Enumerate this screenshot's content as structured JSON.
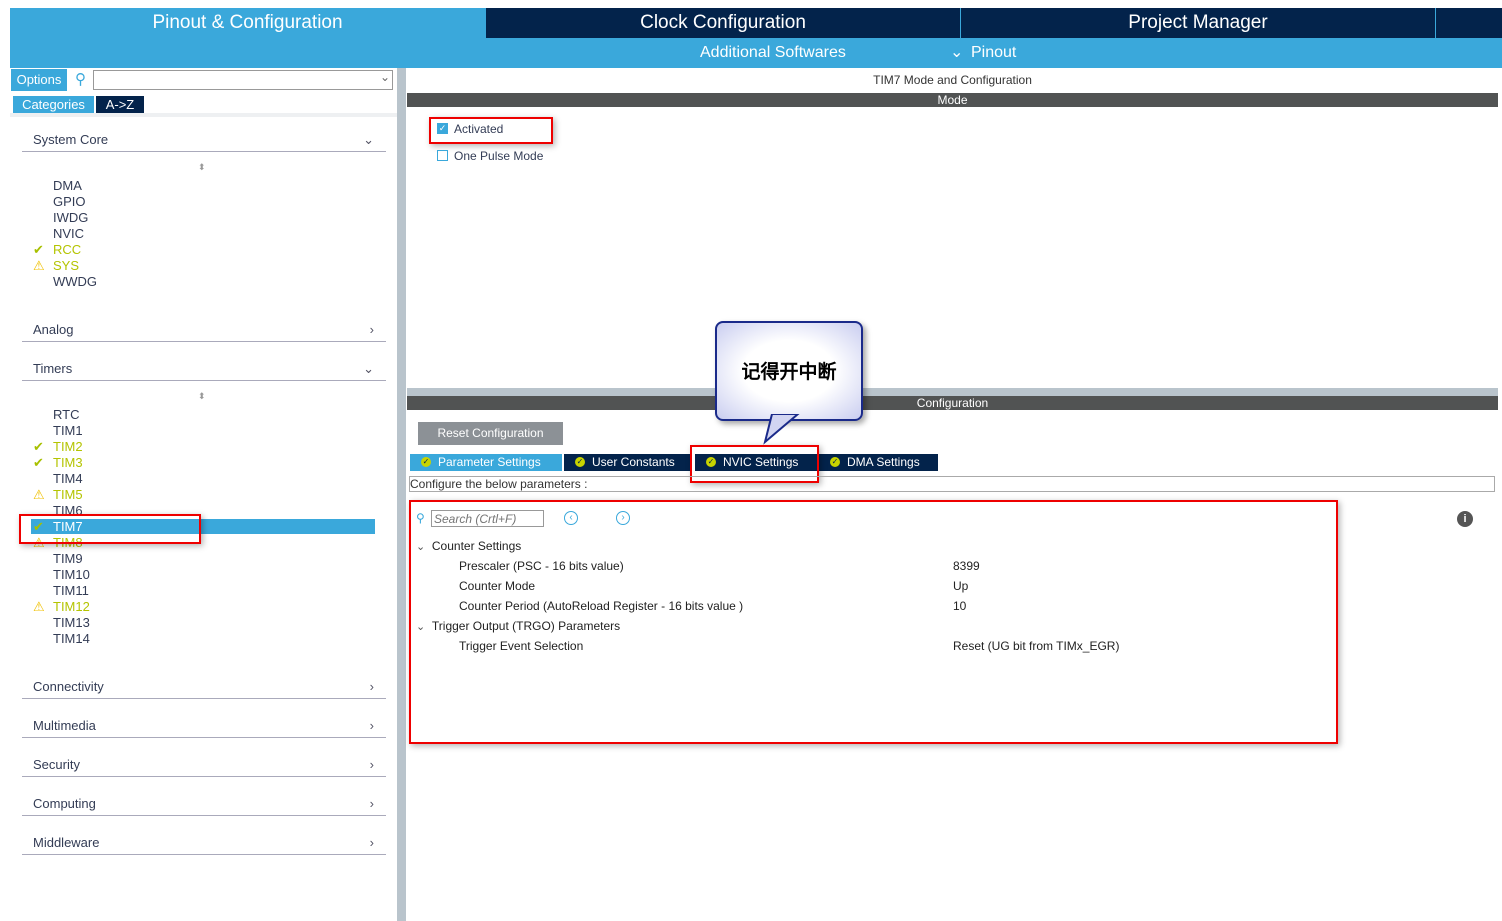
{
  "top_tabs": [
    {
      "label": "Pinout & Configuration",
      "active": true
    },
    {
      "label": "Clock Configuration"
    },
    {
      "label": "Project Manager"
    }
  ],
  "sub_tabs": {
    "additional": "Additional Softwares",
    "pinout": "Pinout"
  },
  "left": {
    "options": "Options",
    "search_placeholder": "",
    "categories_tab": "Categories",
    "az_tab": "A->Z",
    "system_core": {
      "label": "System Core",
      "items": [
        {
          "label": "DMA",
          "status": ""
        },
        {
          "label": "GPIO",
          "status": ""
        },
        {
          "label": "IWDG",
          "status": ""
        },
        {
          "label": "NVIC",
          "status": ""
        },
        {
          "label": "RCC",
          "status": "ok"
        },
        {
          "label": "SYS",
          "status": "warn"
        },
        {
          "label": "WWDG",
          "status": ""
        }
      ]
    },
    "analog": "Analog",
    "timers": {
      "label": "Timers",
      "items": [
        {
          "label": "RTC",
          "status": ""
        },
        {
          "label": "TIM1",
          "status": ""
        },
        {
          "label": "TIM2",
          "status": "ok"
        },
        {
          "label": "TIM3",
          "status": "ok"
        },
        {
          "label": "TIM4",
          "status": ""
        },
        {
          "label": "TIM5",
          "status": "warn"
        },
        {
          "label": "TIM6",
          "status": ""
        },
        {
          "label": "TIM7",
          "status": "ok",
          "selected": true
        },
        {
          "label": "TIM8",
          "status": "warn"
        },
        {
          "label": "TIM9",
          "status": ""
        },
        {
          "label": "TIM10",
          "status": ""
        },
        {
          "label": "TIM11",
          "status": ""
        },
        {
          "label": "TIM12",
          "status": "warn"
        },
        {
          "label": "TIM13",
          "status": ""
        },
        {
          "label": "TIM14",
          "status": ""
        }
      ]
    },
    "other_categories": [
      "Connectivity",
      "Multimedia",
      "Security",
      "Computing",
      "Middleware"
    ]
  },
  "right": {
    "title": "TIM7 Mode and Configuration",
    "mode_header": "Mode",
    "activated": {
      "label": "Activated",
      "checked": true
    },
    "one_pulse": {
      "label": "One Pulse Mode",
      "checked": false
    },
    "callout": "记得开中断",
    "config_header": "Configuration",
    "reset_button": "Reset Configuration",
    "config_tabs": [
      "Parameter Settings",
      "User Constants",
      "NVIC Settings",
      "DMA Settings"
    ],
    "configure_text": "Configure the below parameters :",
    "search_placeholder": "Search (Crtl+F)",
    "groups": [
      {
        "label": "Counter Settings",
        "params": [
          {
            "name": "Prescaler (PSC - 16 bits value)",
            "value": "8399"
          },
          {
            "name": "Counter Mode",
            "value": "Up"
          },
          {
            "name": "Counter Period (AutoReload Register - 16 bits value )",
            "value": "10"
          }
        ]
      },
      {
        "label": "Trigger Output (TRGO) Parameters",
        "params": [
          {
            "name": "Trigger Event Selection",
            "value": "Reset (UG bit from TIMx_EGR)"
          }
        ]
      }
    ]
  },
  "colors": {
    "accent": "#3aa8db",
    "navy": "#03234b",
    "ok": "#b4c400",
    "warn": "#f0c000",
    "highlight": "#e00000"
  }
}
